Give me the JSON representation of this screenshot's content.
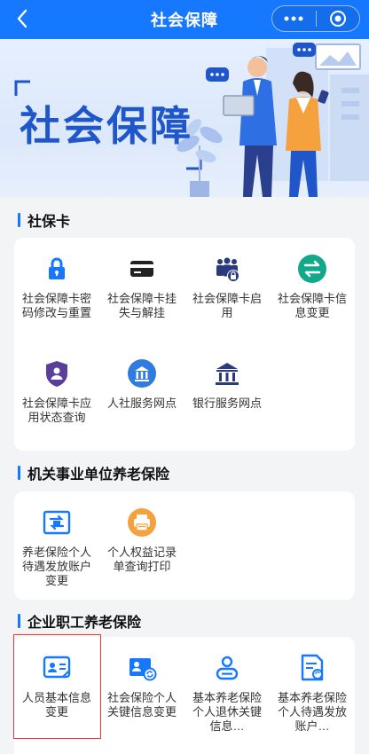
{
  "header": {
    "title": "社会保障"
  },
  "banner": {
    "title": "社会保障"
  },
  "sections": [
    {
      "title": "社保卡",
      "items": [
        {
          "label": "社会保障卡密码修改与重置",
          "icon": "lock-icon"
        },
        {
          "label": "社会保障卡挂失与解挂",
          "icon": "card-icon"
        },
        {
          "label": "社会保障卡启用",
          "icon": "people-lock-icon"
        },
        {
          "label": "社会保障卡信息变更",
          "icon": "exchange-icon"
        },
        {
          "label": "社会保障卡应用状态查询",
          "icon": "shield-user-icon"
        },
        {
          "label": "人社服务网点",
          "icon": "bank-building-icon"
        },
        {
          "label": "银行服务网点",
          "icon": "bank-icon"
        }
      ]
    },
    {
      "title": "机关事业单位养老保险",
      "items": [
        {
          "label": "养老保险个人待遇发放账户变更",
          "icon": "account-change-icon"
        },
        {
          "label": "个人权益记录单查询打印",
          "icon": "printer-icon"
        }
      ]
    },
    {
      "title": "企业职工养老保险",
      "items": [
        {
          "label": "人员基本信息变更",
          "icon": "id-card-icon"
        },
        {
          "label": "社会保险个人关键信息变更",
          "icon": "card-refresh-icon"
        },
        {
          "label": "基本养老保险个人退休关键信息…",
          "icon": "user-retire-icon"
        },
        {
          "label": "基本养老保险个人待遇发放账户…",
          "icon": "document-refresh-icon"
        }
      ]
    }
  ],
  "colors": {
    "primary": "#1677ff",
    "accent": "#1f56c9",
    "orange": "#f5a13d",
    "highlight": "#e53935"
  }
}
